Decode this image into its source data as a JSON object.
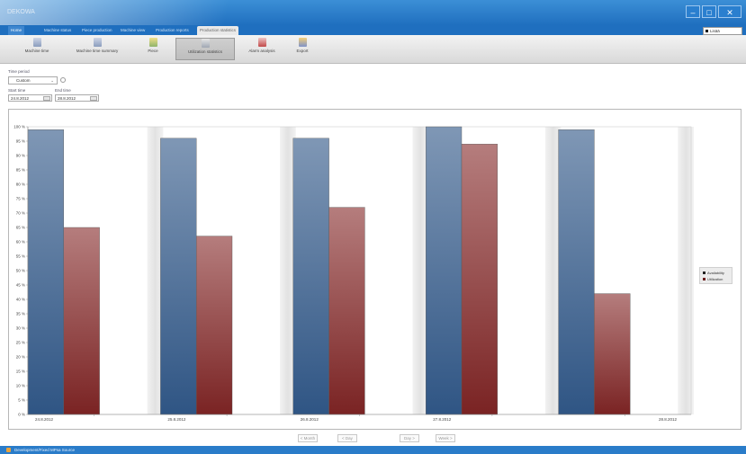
{
  "app": {
    "title": "DEKOWA"
  },
  "window_controls": {
    "minimize": "–",
    "maximize": "□",
    "close": "✕"
  },
  "tabs": [
    {
      "label": "Home"
    },
    {
      "label": "Machine status"
    },
    {
      "label": "Piece production"
    },
    {
      "label": "Machine view"
    },
    {
      "label": "Production reports"
    },
    {
      "label": "Production statistics"
    }
  ],
  "language": {
    "value": "Lisää"
  },
  "ribbon": [
    {
      "label": "Machine time",
      "icon": "document-icon"
    },
    {
      "label": "Machine time summary",
      "icon": "document-icon"
    },
    {
      "label": "Piece",
      "icon": "chart-icon"
    },
    {
      "label": "Utilization statistics",
      "icon": "statistics-icon"
    },
    {
      "label": "Alarm analysis",
      "icon": "alarm-icon"
    },
    {
      "label": "Export",
      "icon": "export-icon"
    }
  ],
  "filters": {
    "time_period_label": "Time period",
    "time_period_value": "Custom",
    "start_label": "Start time",
    "start_value": "24.8.2012",
    "end_label": "End time",
    "end_value": "28.8.2012"
  },
  "pager": {
    "month": "< Month",
    "day": "< Day",
    "day_next": "Day >",
    "week_next": "Week >"
  },
  "status": {
    "text": "Development/Fixed MPsa Source"
  },
  "colors": {
    "availability": "#3d6288",
    "utilization": "#8e3a3a",
    "title_bar": "#1f6fbf"
  },
  "chart_data": {
    "type": "bar",
    "categories": [
      "24.8.2012",
      "25.8.2012",
      "26.8.2012",
      "27.8.2012",
      "28.8.2012"
    ],
    "series": [
      {
        "name": "Availability",
        "values": [
          99,
          96,
          96,
          100,
          99
        ]
      },
      {
        "name": "Utilization",
        "values": [
          65,
          62,
          72,
          94,
          42
        ]
      }
    ],
    "yticks": [
      "0 %",
      "5 %",
      "10 %",
      "15 %",
      "20 %",
      "25 %",
      "30 %",
      "35 %",
      "40 %",
      "45 %",
      "50 %",
      "55 %",
      "60 %",
      "65 %",
      "70 %",
      "75 %",
      "80 %",
      "85 %",
      "90 %",
      "95 %",
      "100 %"
    ],
    "ylim": [
      0,
      100
    ],
    "grid": false,
    "legend": "right"
  }
}
